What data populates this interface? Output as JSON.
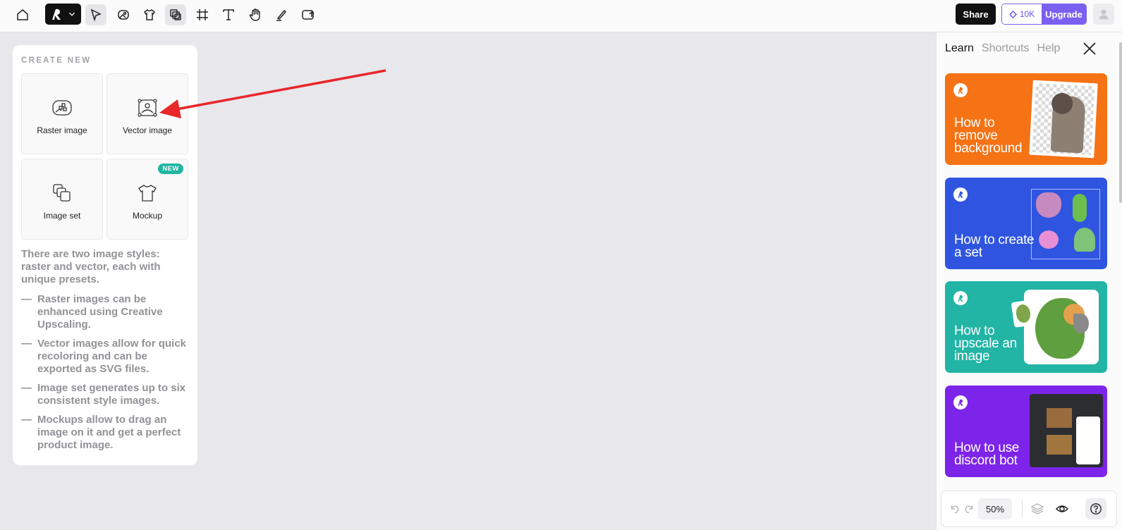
{
  "toolbar": {
    "icons": [
      "home-icon",
      "logo-menu",
      "select-tool-icon",
      "image-tool-icon",
      "mockup-tool-icon",
      "image-set-tool-icon",
      "frame-tool-icon",
      "text-tool-icon",
      "hand-tool-icon",
      "draw-tool-icon",
      "upload-icon"
    ],
    "share_label": "Share",
    "credits_count": "10K",
    "upgrade_label": "Upgrade"
  },
  "create_panel": {
    "title": "CREATE NEW",
    "tiles": [
      {
        "label": "Raster image",
        "icon": "raster-image-icon"
      },
      {
        "label": "Vector image",
        "icon": "vector-image-icon"
      },
      {
        "label": "Image set",
        "icon": "image-set-icon"
      },
      {
        "label": "Mockup",
        "icon": "mockup-shirt-icon",
        "badge": "NEW"
      }
    ],
    "intro": "There are two image styles: raster and vector, each with unique presets.",
    "bullets": [
      "Raster images can be enhanced using Creative Upscaling.",
      "Vector images allow for quick recoloring and can be exported as SVG files.",
      "Image set generates up to six consistent style images.",
      "Mockups allow to drag an image on it and get a perfect product image."
    ],
    "dash": "—"
  },
  "learn_panel": {
    "tabs": [
      "Learn",
      "Shortcuts",
      "Help"
    ],
    "active_tab": "Learn",
    "cards": [
      {
        "title": "How to remove background",
        "color": "#f57215"
      },
      {
        "title": "How to create a set",
        "color": "#2f55e0"
      },
      {
        "title": "How to upscale an image",
        "color": "#22b5a5"
      },
      {
        "title": "How to use discord bot",
        "color": "#7d24ea"
      }
    ]
  },
  "bottom_bar": {
    "zoom": "50%"
  },
  "colors": {
    "canvas": "#e8e8ec",
    "accent": "#7a60f0",
    "annotation_arrow": "#e8272a"
  }
}
